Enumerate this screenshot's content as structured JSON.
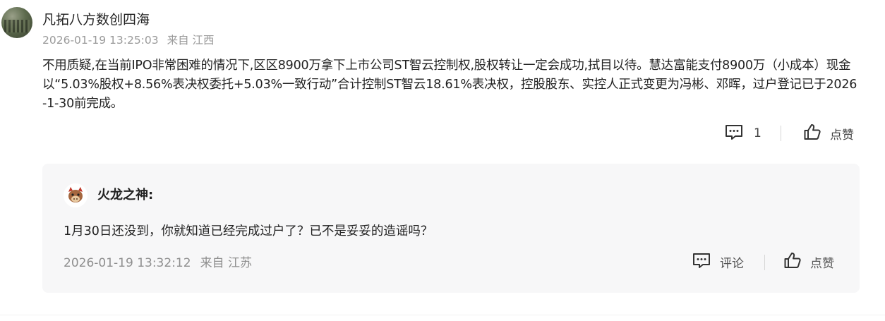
{
  "post": {
    "author": "凡拓八方数创四海",
    "timestamp": "2026-01-19 13:25:03",
    "location": "来自 江西",
    "body": "不用质疑,在当前IPO非常困难的情况下,区区8900万拿下上市公司ST智云控制权,股权转让一定会成功,拭目以待。慧达富能支付8900万（小成本）现金以“5.03%股权+8.56%表决权委托+5.03%一致行动”合计控制ST智云18.61%表决权，控股股东、实控人正式变更为冯彬、邓晖，过户登记已于2026-1-30前完成。",
    "comment_icon": "comment-icon",
    "comment_count": "1",
    "like_icon": "thumbs-up-icon",
    "like_label": "点赞"
  },
  "reply": {
    "author": "火龙之神:",
    "text": "1月30日还没到，你就知道已经完成过户了？已不是妥妥的造谣吗？",
    "timestamp": "2026-01-19 13:32:12",
    "location": "来自 江苏",
    "comment_label": "评论",
    "like_label": "点赞"
  },
  "colors": {
    "text": "#222222",
    "muted": "#9a9a9a",
    "reply_bg": "#f7f7f8"
  }
}
